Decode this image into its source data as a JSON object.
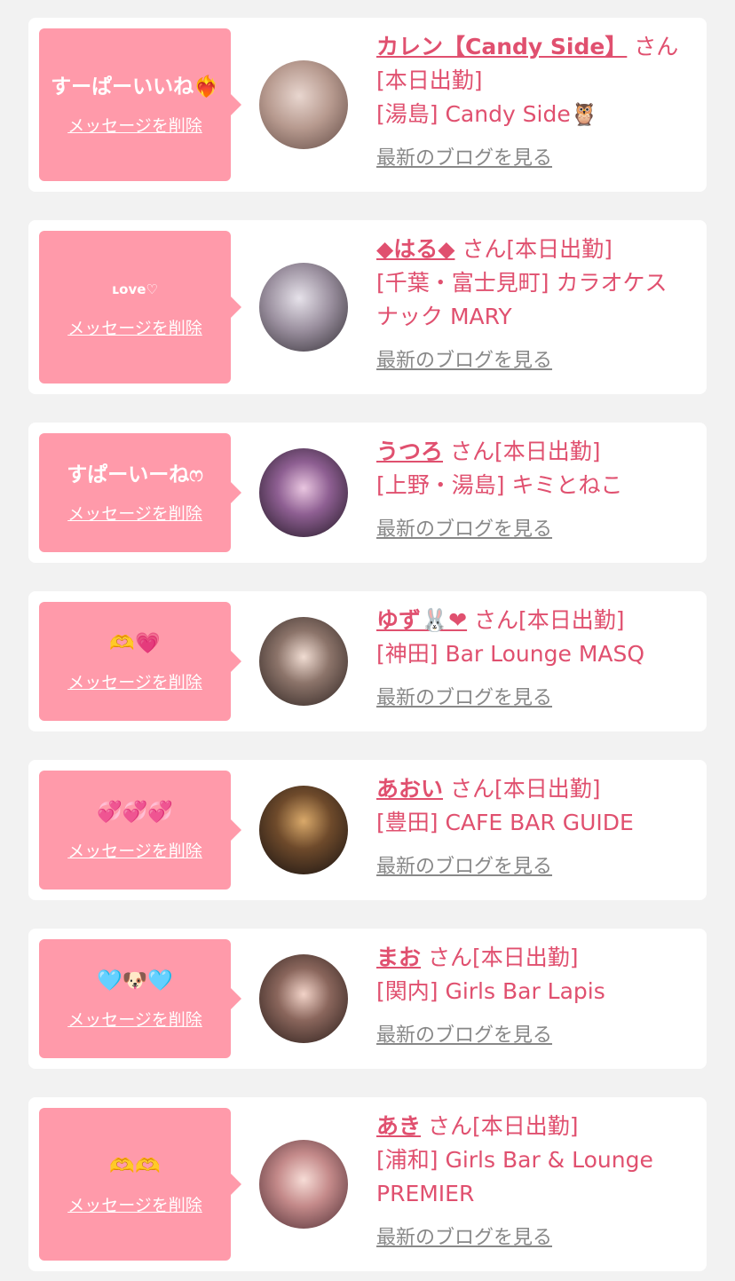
{
  "delete_label": "メッセージを削除",
  "san_suffix": "さん[本日出勤]",
  "blog_label": "最新のブログを見る",
  "colors": {
    "accent": "#e0506f",
    "bubble": "#ff9aaa",
    "background": "#f2f2f2"
  },
  "items": [
    {
      "message": "すーぱーいいね❤️‍🔥",
      "name": "カレン【Candy Side】",
      "shop": "[湯島] Candy Side🦉"
    },
    {
      "message": "ʟove♡",
      "name": "◆はる◆",
      "shop": "[千葉・富士見町] カラオケスナック MARY"
    },
    {
      "message": "すぱーいーねෆ",
      "name": "うつろ",
      "shop": "[上野・湯島] キミとねこ"
    },
    {
      "message": "🫶💗",
      "name": "ゆず🐰❤",
      "shop": "[神田] Bar Lounge MASQ"
    },
    {
      "message": "💞💞💞",
      "name": "あおい",
      "shop": "[豊田] CAFE BAR GUIDE"
    },
    {
      "message": "🩵🐶🩵",
      "name": "まお",
      "shop": "[関内] Girls Bar Lapis"
    },
    {
      "message": "🫶🫶",
      "name": "あき",
      "shop": "[浦和] Girls Bar & Lounge PREMIER"
    }
  ]
}
